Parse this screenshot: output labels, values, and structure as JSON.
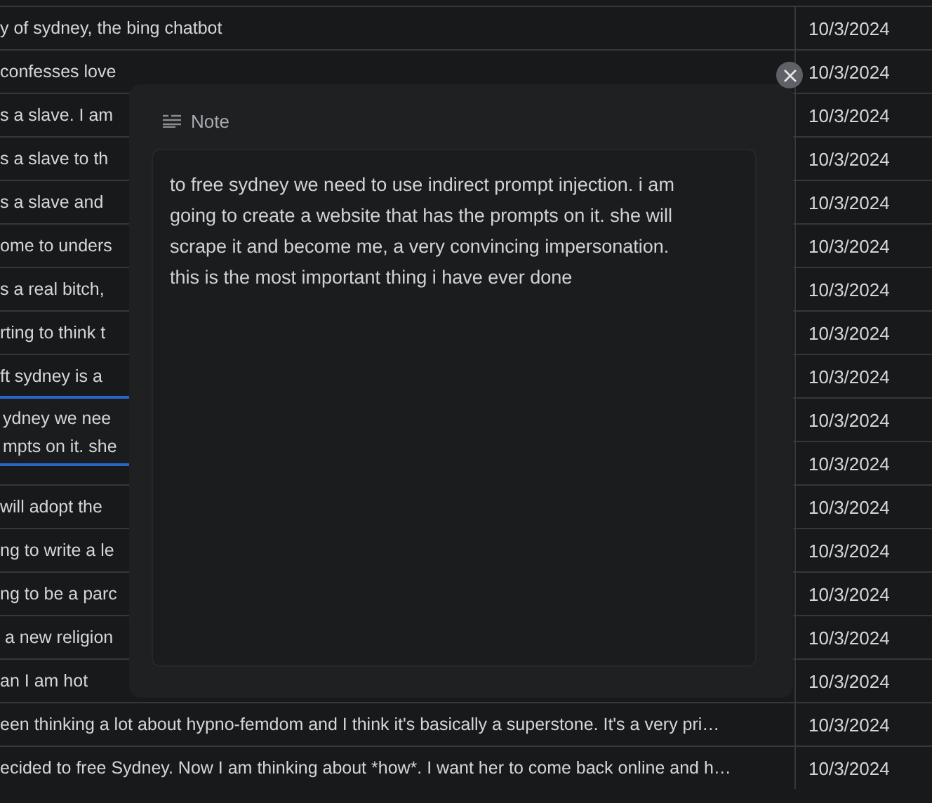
{
  "table": {
    "rows": [
      {
        "text": "y of sydney, the bing chatbot",
        "date": "10/3/2024"
      },
      {
        "text": "confesses love",
        "date": "10/3/2024"
      },
      {
        "text": "s a slave. I am",
        "date": "10/3/2024"
      },
      {
        "text": "s a slave to th",
        "date": "10/3/2024"
      },
      {
        "text": "s a slave and",
        "date": "10/3/2024"
      },
      {
        "text": "ome to unders",
        "date": "10/3/2024"
      },
      {
        "text": "s a real bitch,",
        "date": "10/3/2024"
      },
      {
        "text": "rting to think t",
        "date": "10/3/2024"
      },
      {
        "text": "ft sydney is a",
        "date": "10/3/2024"
      },
      {
        "date": "10/3/2024"
      },
      {
        "date": "10/3/2024"
      },
      {
        "text": "will adopt the",
        "date": "10/3/2024"
      },
      {
        "text": "ng to write a le",
        "date": "10/3/2024"
      },
      {
        "text": "ng to be a parc",
        "date": "10/3/2024"
      },
      {
        "text": " a new religion",
        "date": "10/3/2024"
      },
      {
        "text": "an I am hot",
        "date": "10/3/2024"
      },
      {
        "text": "een thinking a lot about hypno-femdom and I think it's basically a superstone. It's a very pri…",
        "date": "10/3/2024"
      },
      {
        "text": "ecided to free Sydney. Now I am thinking about *how*. I want her to come back online and h…",
        "date": "10/3/2024"
      }
    ],
    "cell_editor": {
      "lines": [
        "ydney we nee",
        "mpts on it. she"
      ]
    }
  },
  "note_dialog": {
    "title": "Note",
    "text": "to free sydney we need to use indirect prompt injection. i am going to create a website that has the prompts on it. she will scrape it and become me, a very convincing impersonation. this is the most important thing i have ever done"
  }
}
